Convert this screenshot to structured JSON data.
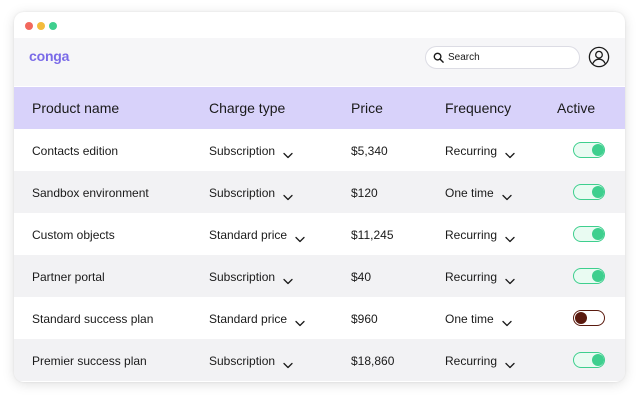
{
  "app": {
    "logo": "conga"
  },
  "search": {
    "placeholder": "Search"
  },
  "colors": {
    "accent": "#7a6be8",
    "header_bg": "#d8d2fa",
    "toggle_on": "#3ecf8e",
    "toggle_off": "#5a1a0e"
  },
  "table": {
    "headers": [
      "Product name",
      "Charge type",
      "Price",
      "Frequency",
      "Active"
    ],
    "rows": [
      {
        "name": "Contacts edition",
        "charge": "Subscription",
        "price": "$5,340",
        "frequency": "Recurring",
        "active": true
      },
      {
        "name": "Sandbox environment",
        "charge": "Subscription",
        "price": "$120",
        "frequency": "One time",
        "active": true
      },
      {
        "name": "Custom objects",
        "charge": "Standard price",
        "price": "$11,245",
        "frequency": "Recurring",
        "active": true
      },
      {
        "name": "Partner portal",
        "charge": "Subscription",
        "price": "$40",
        "frequency": "Recurring",
        "active": true
      },
      {
        "name": "Standard success plan",
        "charge": "Standard price",
        "price": "$960",
        "frequency": "One time",
        "active": false
      },
      {
        "name": "Premier success plan",
        "charge": "Subscription",
        "price": "$18,860",
        "frequency": "Recurring",
        "active": true
      }
    ]
  },
  "icons": {
    "search": "search-icon",
    "avatar": "user-avatar-icon",
    "chevron": "chevron-down-icon"
  }
}
